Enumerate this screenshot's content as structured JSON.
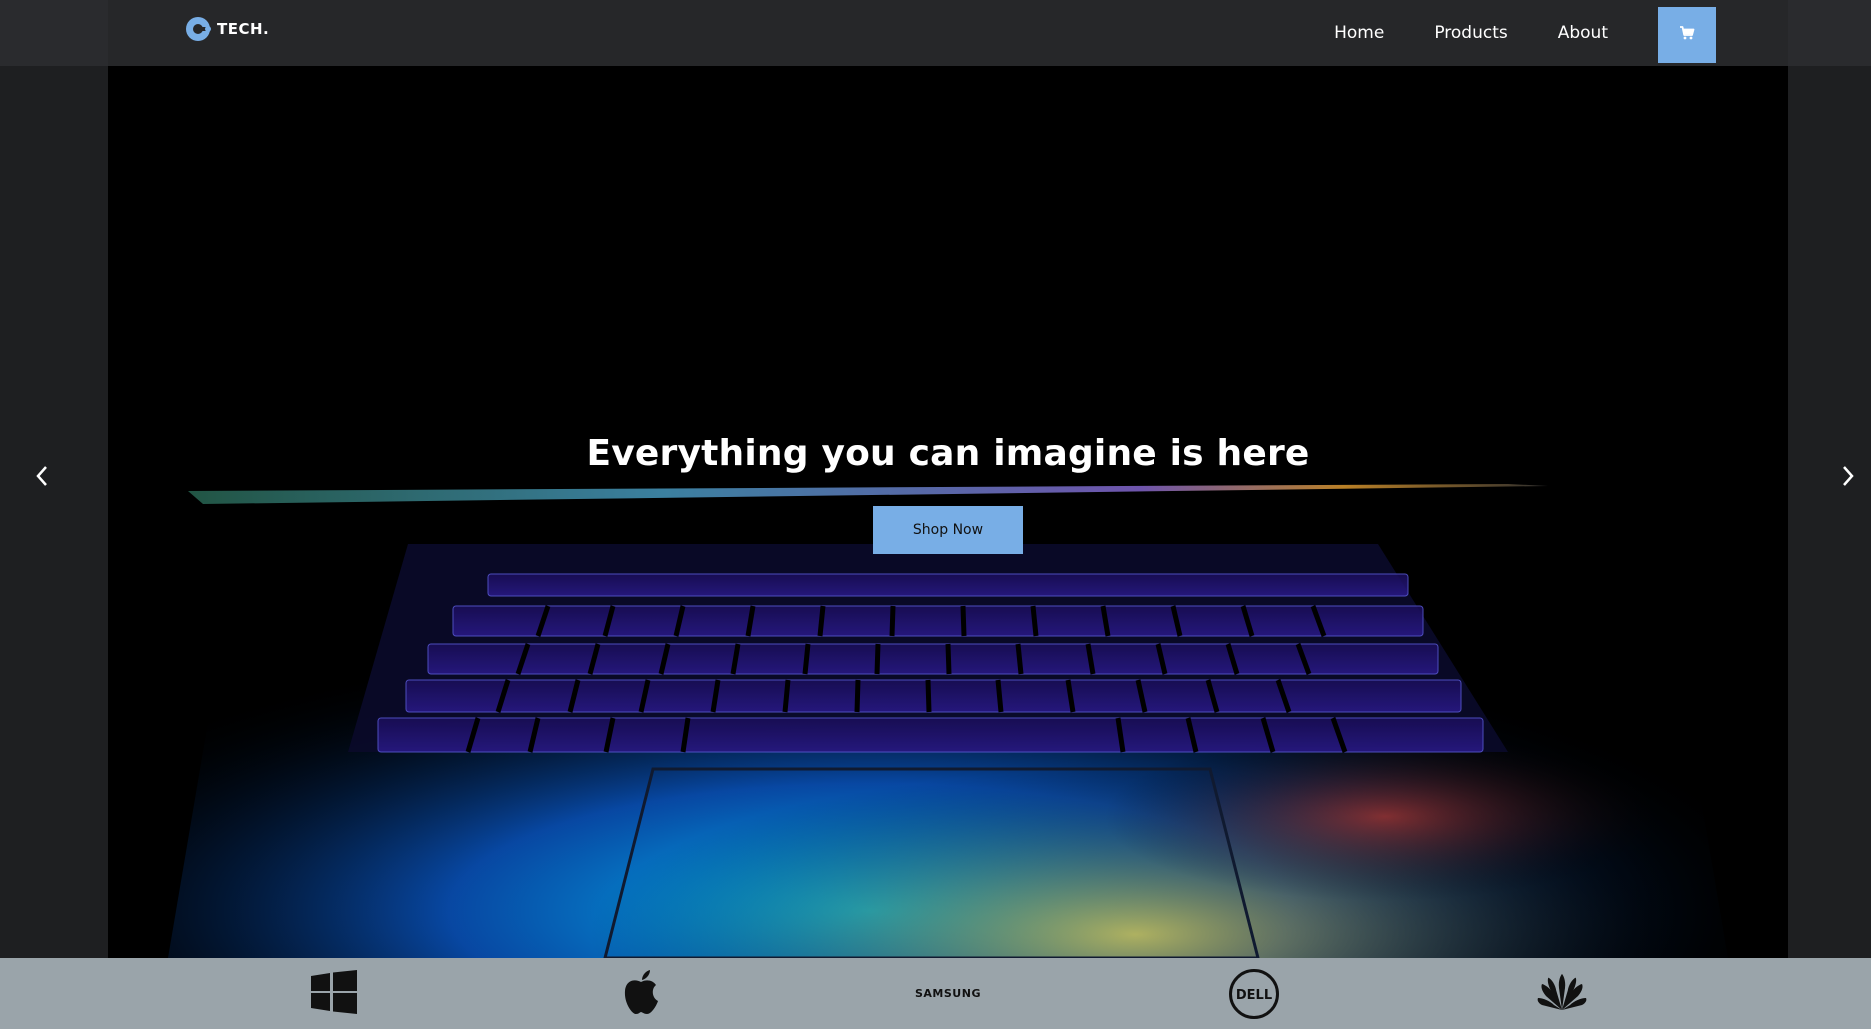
{
  "header": {
    "logo_text": "TECH.",
    "nav": {
      "home": "Home",
      "products": "Products",
      "about": "About"
    },
    "cart_icon": "cart-icon"
  },
  "hero": {
    "title": "Everything you can imagine is here",
    "cta_label": "Shop Now",
    "prev_icon": "chevron-left-icon",
    "next_icon": "chevron-right-icon"
  },
  "brands": {
    "samsung_label": "SAMSUNG",
    "dell_label": "DELL",
    "icons": [
      "windows-icon",
      "apple-icon",
      "samsung-logo",
      "dell-logo",
      "huawei-icon"
    ]
  },
  "colors": {
    "accent": "#78aee6",
    "header_bg": "#262729",
    "brand_strip_bg": "#9aa4aa"
  }
}
